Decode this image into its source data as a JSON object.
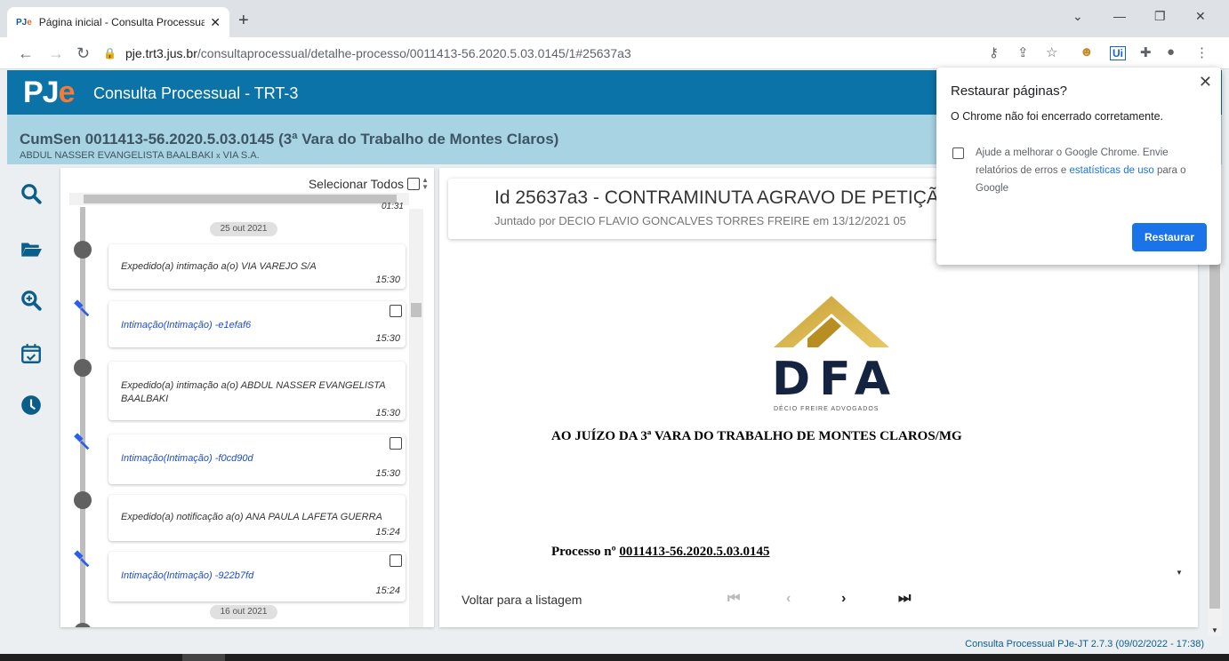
{
  "browser": {
    "tab_title": "Página inicial - Consulta Processual",
    "favicon": "PJe",
    "url_host": "pje.trt3.jus.br",
    "url_path": "/consultaprocessual/detalhe-processo/0011413-56.2020.5.03.0145/1#25637a3"
  },
  "app": {
    "logo": "PJ",
    "logo_e": "e",
    "title": "Consulta Processual - TRT-3"
  },
  "process": {
    "title": "CumSen 0011413-56.2020.5.03.0145 (3ª Vara do Trabalho de Montes Claros)",
    "party_a": "ABDUL NASSER EVANGELISTA BAALBAKI",
    "versus": "x",
    "party_b": "VIA S.A."
  },
  "timeline": {
    "select_all_label": "Selecionar Todos",
    "cut_time": "01:31",
    "dates": [
      "25 out 2021",
      "16 out 2021"
    ],
    "items": [
      {
        "text": "Expedido(a) intimação a(o) VIA VAREJO S/A",
        "time": "15:30",
        "link": false
      },
      {
        "text": "Intimação(Intimação) -e1efaf6",
        "time": "15:30",
        "link": true
      },
      {
        "text": "Expedido(a) intimação a(o) ABDUL NASSER EVANGELISTA BAALBAKI",
        "time": "15:30",
        "link": false
      },
      {
        "text": "Intimação(Intimação) -f0cd90d",
        "time": "15:30",
        "link": true
      },
      {
        "text": "Expedido(a) notificação a(o) ANA PAULA LAFETA GUERRA",
        "time": "15:24",
        "link": false
      },
      {
        "text": "Intimação(Intimação) -922b7fd",
        "time": "15:24",
        "link": true
      }
    ]
  },
  "document": {
    "id_title": "Id 25637a3 - CONTRAMINUTA AGRAVO DE PETIÇÃO",
    "joined_by": "Juntado por DECIO FLAVIO GONCALVES TORRES FREIRE em 13/12/2021 05",
    "logo_text": "DFA",
    "logo_sub": "DÉCIO FREIRE ADVOGADOS",
    "heading": "AO JUÍZO DA 3ª VARA DO TRABALHO DE MONTES CLAROS/MG",
    "process_label": "Processo nº",
    "process_number": "0011413-56.2020.5.03.0145",
    "back_label": "Voltar para a listagem"
  },
  "footer": {
    "version": "Consulta Processual PJe-JT 2.7.3 (09/02/2022 - 17:38)"
  },
  "popup": {
    "title": "Restaurar páginas?",
    "message": "O Chrome não foi encerrado corretamente.",
    "help_text": "Ajude a melhorar o Google Chrome. Envie relatórios de erros e",
    "help_link": "estatísticas de uso",
    "help_suffix": "para o Google",
    "restore_label": "Restaurar"
  },
  "colors": {
    "header": "#0b73a7",
    "process_bar": "#a7d3e3",
    "link": "#1c4bd8",
    "accent": "#f47b36",
    "button": "#1a73e8"
  }
}
